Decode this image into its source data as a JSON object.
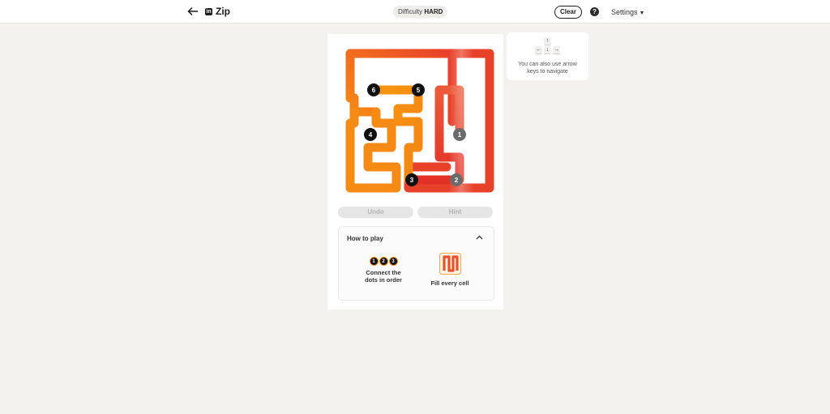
{
  "header": {
    "app_name": "Zip",
    "difficulty_label": "Difficulty",
    "difficulty_value": "HARD",
    "clear_label": "Clear",
    "help_label": "?",
    "settings_label": "Settings"
  },
  "board": {
    "dots": [
      {
        "number": "1",
        "state": "visited"
      },
      {
        "number": "2",
        "state": "visited"
      },
      {
        "number": "3",
        "state": "pending"
      },
      {
        "number": "4",
        "state": "pending"
      },
      {
        "number": "5",
        "state": "pending"
      },
      {
        "number": "6",
        "state": "pending"
      }
    ],
    "colors": {
      "path_red": "#e63c2c",
      "path_orange": "#f36a1e",
      "path_amber": "#f7920f",
      "dot_pending": "#111111",
      "dot_visited": "#6b6b6b"
    }
  },
  "controls": {
    "undo_label": "Undo",
    "hint_label": "Hint"
  },
  "how_to_play": {
    "title": "How to play",
    "step1_dots": [
      "1",
      "2",
      "3"
    ],
    "step1_caption_line1": "Connect the",
    "step1_caption_line2": "dots in order",
    "step2_caption": "Fill every cell"
  },
  "hint_card": {
    "line1": "You can also use arrow",
    "line2": "keys to navigate",
    "keys": {
      "up": "↑",
      "left": "←",
      "down": "↓",
      "right": "→"
    }
  }
}
